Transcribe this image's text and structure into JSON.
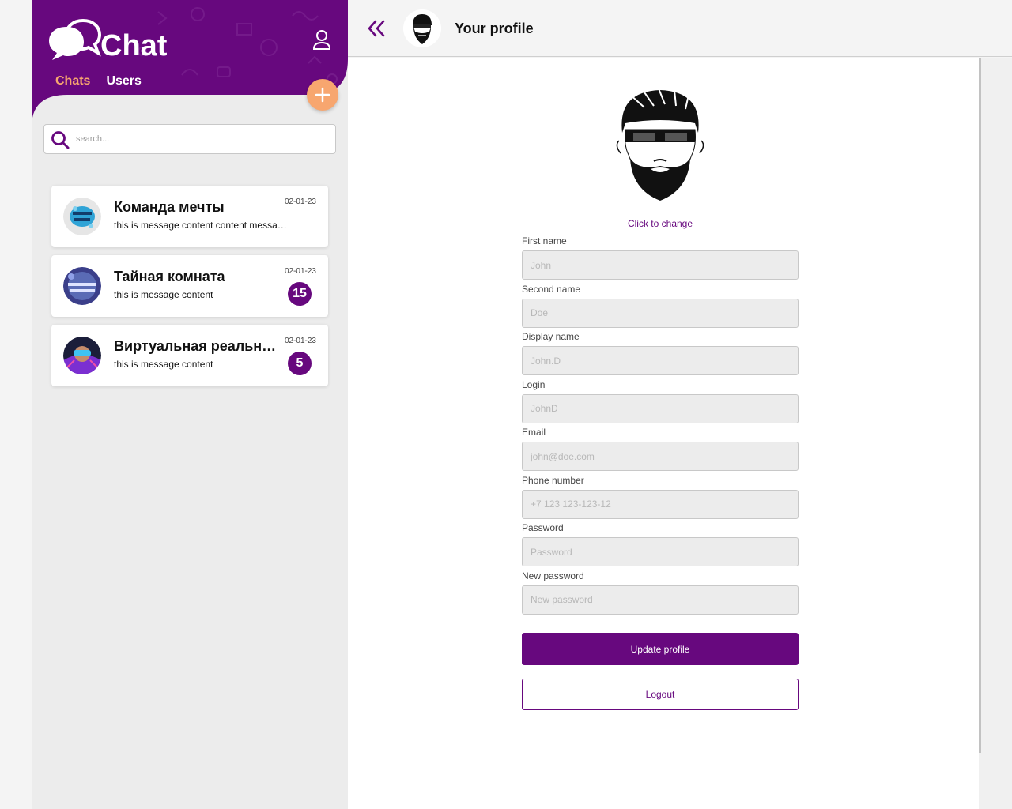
{
  "colors": {
    "brand": "#67087e",
    "accent": "#f7a66f",
    "sidebar_bg": "#ececec"
  },
  "sidebar": {
    "logo_text": "Chat",
    "logo_icon": "chat-bubbles-icon",
    "user_icon": "user-icon",
    "tabs": [
      {
        "label": "Chats",
        "active": true
      },
      {
        "label": "Users",
        "active": false
      }
    ],
    "add_icon": "plus-icon",
    "search": {
      "placeholder": "search...",
      "value": "",
      "icon": "search-icon"
    },
    "chats": [
      {
        "name": "Команда мечты",
        "message": "this is message content content message content",
        "date": "02-01-23",
        "unread": ""
      },
      {
        "name": "Тайная комната",
        "message": "this is message content",
        "date": "02-01-23",
        "unread": "15"
      },
      {
        "name": "Виртуальная реальность",
        "message": "this is message content",
        "date": "02-01-23",
        "unread": "5"
      }
    ]
  },
  "header": {
    "back_icon": "double-chevron-left-icon",
    "title": "Your profile"
  },
  "profile": {
    "change_label": "Click to change",
    "fields": [
      {
        "label": "First name",
        "placeholder": "John",
        "value": ""
      },
      {
        "label": "Second name",
        "placeholder": "Doe",
        "value": ""
      },
      {
        "label": "Display name",
        "placeholder": "John.D",
        "value": ""
      },
      {
        "label": "Login",
        "placeholder": "JohnD",
        "value": ""
      },
      {
        "label": "Email",
        "placeholder": "john@doe.com",
        "value": ""
      },
      {
        "label": "Phone number",
        "placeholder": "+7 123 123-123-12",
        "value": ""
      },
      {
        "label": "Password",
        "placeholder": "Password",
        "value": ""
      },
      {
        "label": "New password",
        "placeholder": "New password",
        "value": ""
      }
    ],
    "update_label": "Update profile",
    "logout_label": "Logout"
  }
}
